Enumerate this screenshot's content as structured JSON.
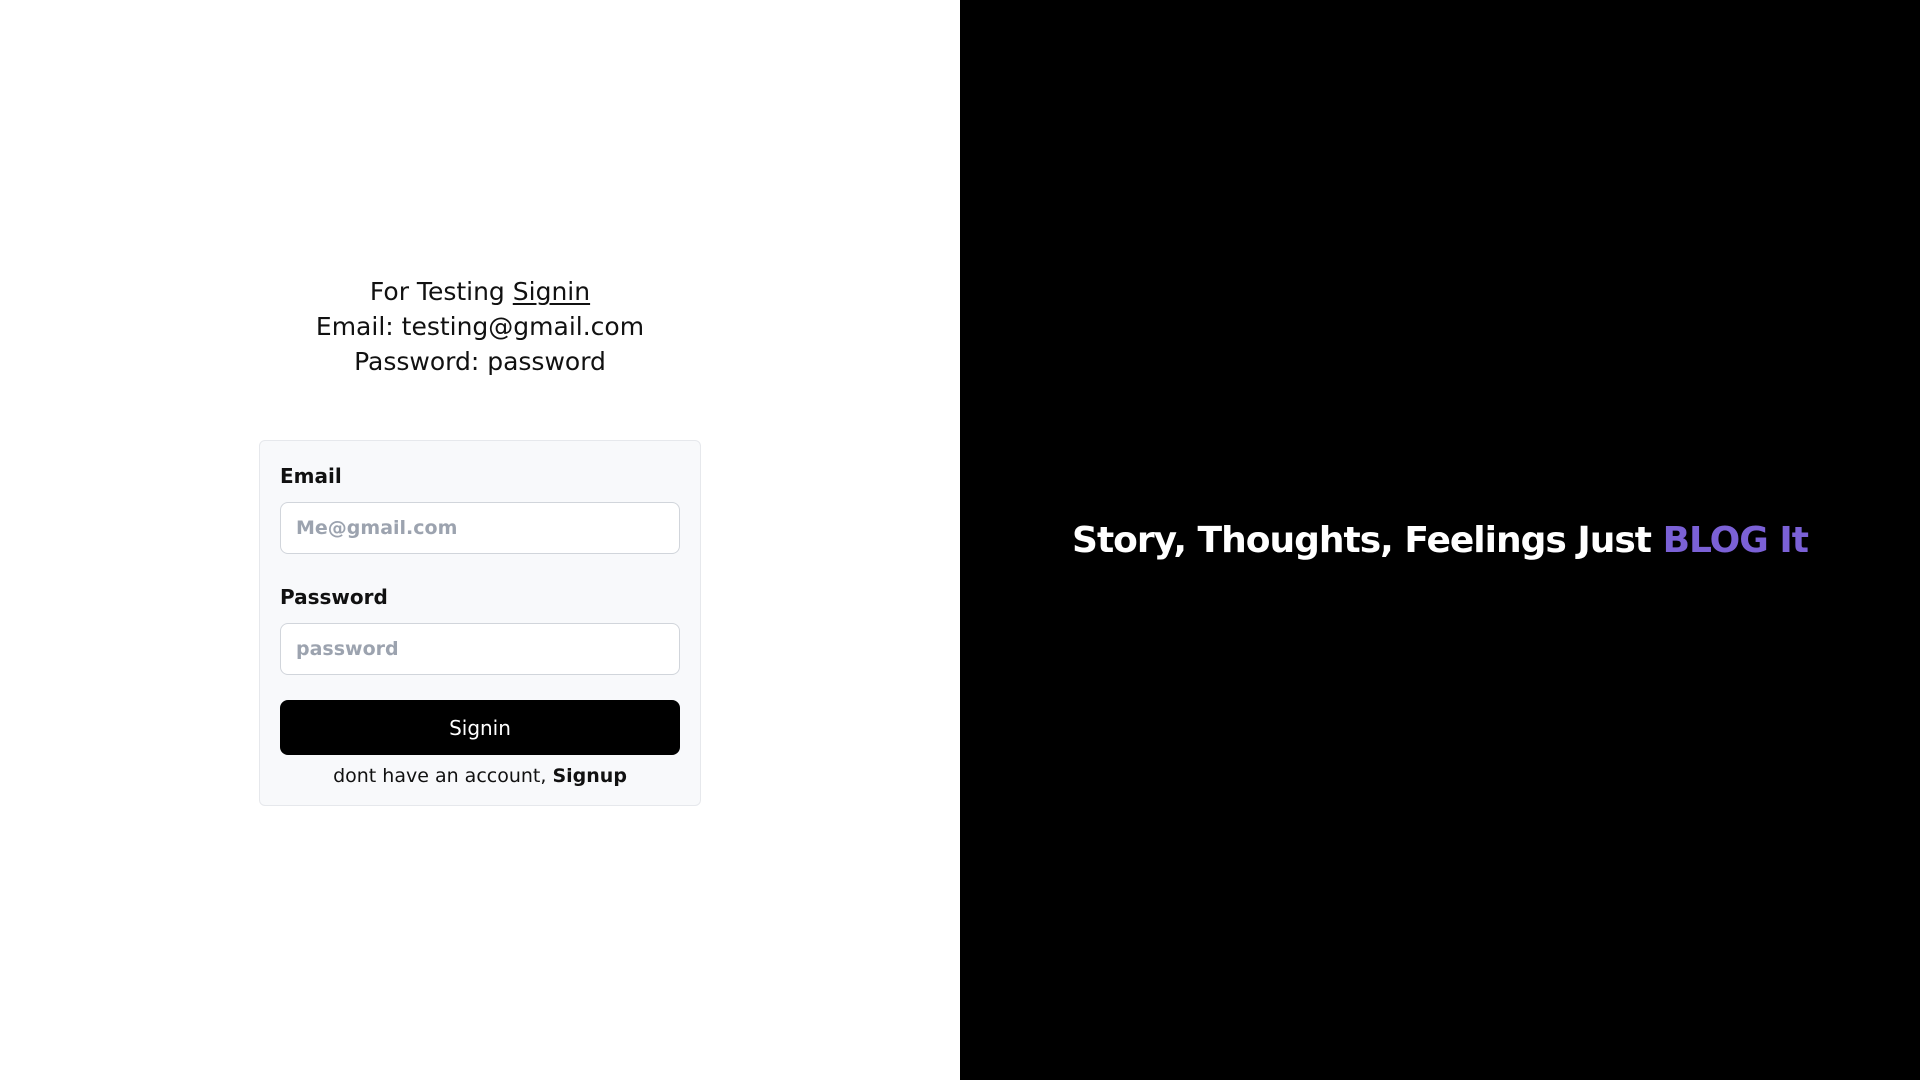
{
  "test_info": {
    "line1_prefix": "For Testing",
    "line1_link": "Signin",
    "line2": "Email: testing@gmail.com",
    "line3": "Password: password"
  },
  "form": {
    "email_label": "Email",
    "email_placeholder": "Me@gmail.com",
    "email_value": "",
    "password_label": "Password",
    "password_placeholder": "password",
    "password_value": "",
    "submit_label": "Signin",
    "signup_prompt": "dont have an account,",
    "signup_link": "Signup"
  },
  "hero": {
    "tagline_main": "Story, Thoughts, Feelings Just",
    "tagline_accent": "BLOG It",
    "accent_color": "#7b61d6"
  },
  "colors": {
    "left_background": "#ffffff",
    "right_background": "#000000",
    "button_background": "#000000",
    "card_background": "#f8f9fb"
  }
}
